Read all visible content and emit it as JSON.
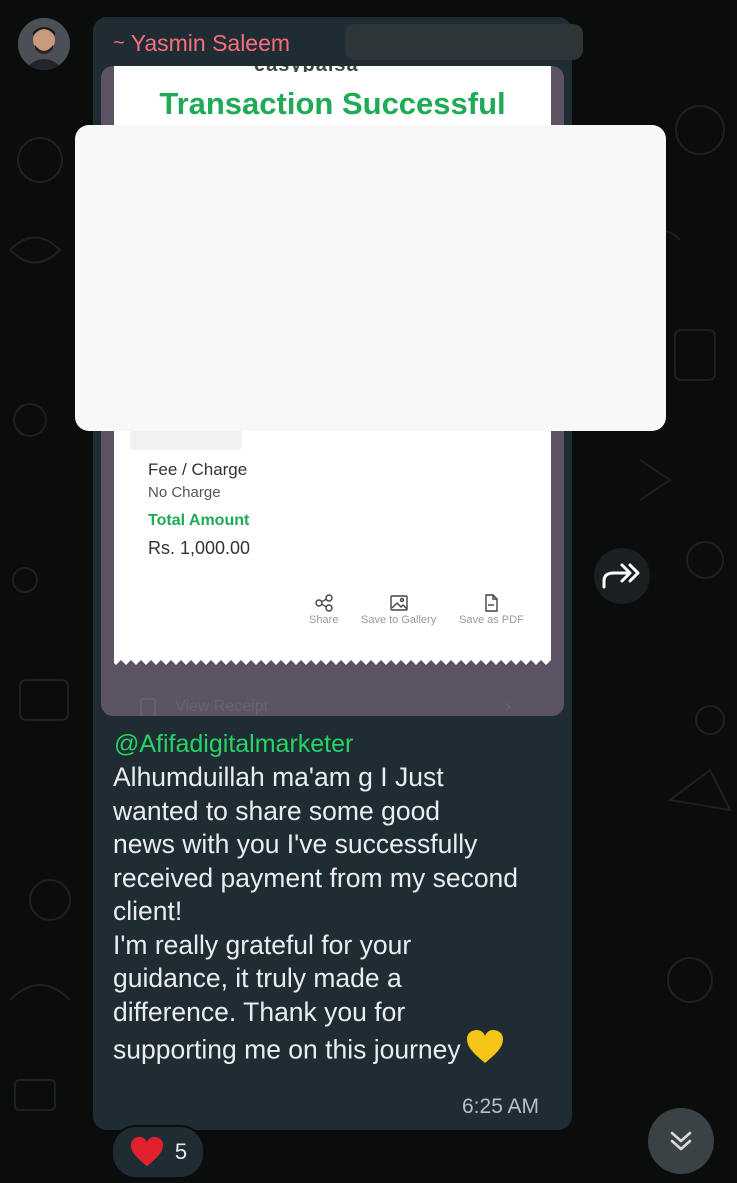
{
  "chat": {
    "sender_prefix": "~",
    "sender_name": "Yasmin Saleem",
    "media": {
      "brand_partial": "easypaisa",
      "title": "Transaction Successful",
      "fee_label": "Fee / Charge",
      "fee_value": "No Charge",
      "total_label": "Total Amount",
      "total_value": "Rs. 1,000.00",
      "actions": [
        {
          "label": "Share",
          "icon": "share-icon"
        },
        {
          "label": "Save to Gallery",
          "icon": "gallery-icon"
        },
        {
          "label": "Save as PDF",
          "icon": "pdf-icon"
        }
      ],
      "view_receipt": "View Receipt"
    },
    "mention": "@Afifadigitalmarketer",
    "message": "Alhumduillah ma'am g I Just\nwanted to share some good\nnews with you  I've successfully\nreceived payment from my second\nclient!\nI'm really grateful for your\nguidance, it truly made a\ndifference. Thank you for\nsupporting me on this journey",
    "message_emoji": "yellow-heart",
    "time": "6:25 AM",
    "reaction": {
      "emoji": "red-heart",
      "count": "5"
    }
  },
  "colors": {
    "background": "#0b0d0c",
    "bubble": "#202c33",
    "sender": "#f5707c",
    "mention": "#25d366",
    "success": "#1faa55"
  }
}
